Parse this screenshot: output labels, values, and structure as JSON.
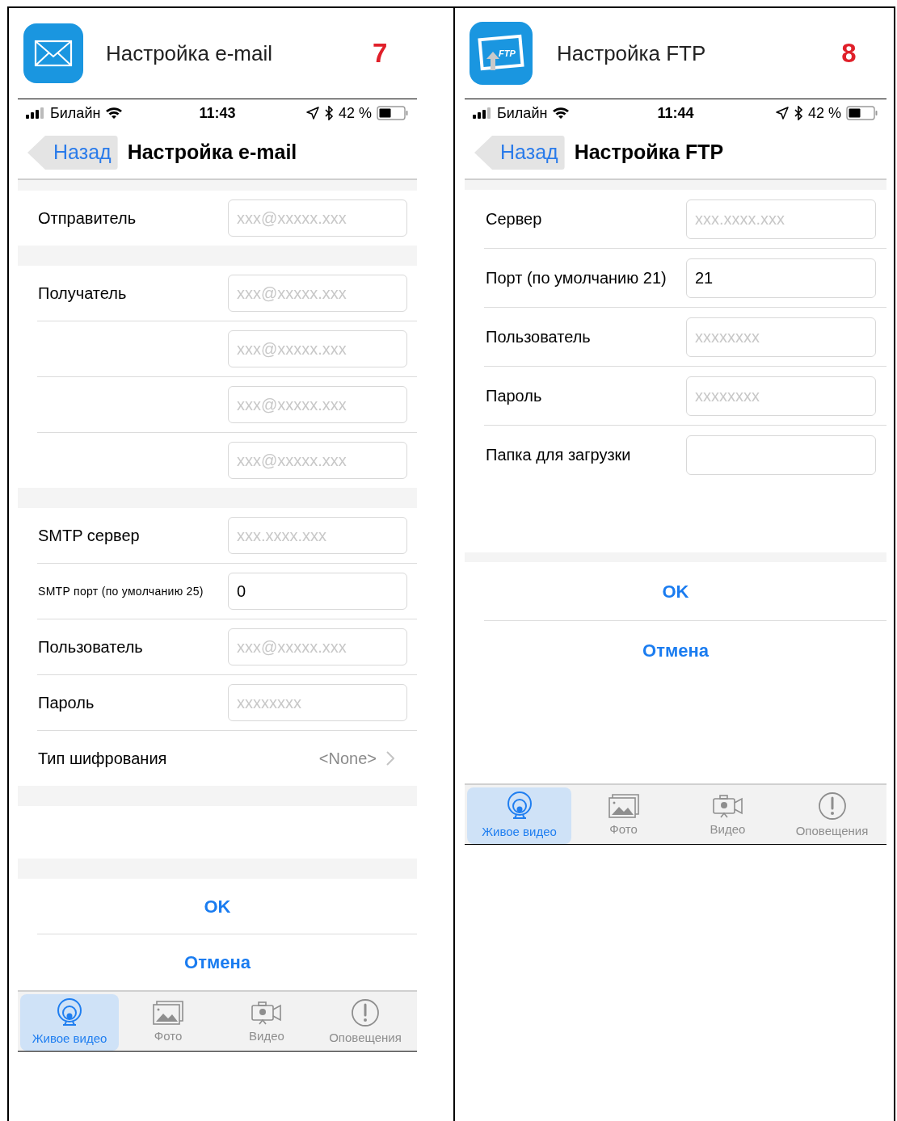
{
  "panels": [
    {
      "kind": "email",
      "title": "Настройка e-mail",
      "number": "7",
      "status_bar": {
        "carrier": "Билайн",
        "time": "11:43",
        "battery": "42 %"
      },
      "nav": {
        "back": "Назад",
        "title": "Настройка e-mail"
      },
      "items": [
        {
          "kind": "thin_gap"
        },
        {
          "kind": "field",
          "label": "Отправитель",
          "placeholder": "xxx@xxxxx.xxx"
        },
        {
          "kind": "gap"
        },
        {
          "kind": "field",
          "label": "Получатель",
          "placeholder": "xxx@xxxxx.xxx"
        },
        {
          "kind": "field",
          "placeholder": "xxx@xxxxx.xxx"
        },
        {
          "kind": "field",
          "placeholder": "xxx@xxxxx.xxx"
        },
        {
          "kind": "field",
          "placeholder": "xxx@xxxxx.xxx"
        },
        {
          "kind": "gap"
        },
        {
          "kind": "field",
          "label": "SMTP сервер",
          "placeholder": "xxx.xxxx.xxx"
        },
        {
          "kind": "field_compact",
          "label": "SMTP порт (по умолчанию 25)",
          "value": "0"
        },
        {
          "kind": "field",
          "label": "Пользователь",
          "placeholder": "xxx@xxxxx.xxx"
        },
        {
          "kind": "field",
          "label": "Пароль",
          "placeholder": "xxxxxxxx"
        },
        {
          "kind": "select",
          "label": "Тип шифрования",
          "value": "<None>"
        },
        {
          "kind": "gap"
        },
        {
          "kind": "blank"
        },
        {
          "kind": "gap"
        },
        {
          "kind": "action",
          "label": "OK"
        },
        {
          "kind": "action",
          "label": "Отмена"
        }
      ],
      "tabs": [
        {
          "label": "Живое видео",
          "selected": true
        },
        {
          "label": "Фото",
          "selected": false
        },
        {
          "label": "Видео",
          "selected": false
        },
        {
          "label": "Оповещения",
          "selected": false
        }
      ]
    },
    {
      "kind": "ftp",
      "icon_text": "FTP",
      "title": "Настройка FTP",
      "number": "8",
      "status_bar": {
        "carrier": "Билайн",
        "time": "11:44",
        "battery": "42 %"
      },
      "nav": {
        "back": "Назад",
        "title": "Настройка FTP"
      },
      "items": [
        {
          "kind": "thin_gap"
        },
        {
          "kind": "field",
          "label": "Сервер",
          "placeholder": "xxx.xxxx.xxx"
        },
        {
          "kind": "field",
          "label": "Порт (по умолчанию 21)",
          "value": "21"
        },
        {
          "kind": "field",
          "label": "Пользователь",
          "placeholder": "xxxxxxxx"
        },
        {
          "kind": "field",
          "label": "Пароль",
          "placeholder": "xxxxxxxx"
        },
        {
          "kind": "field",
          "label": "Папка для загрузки"
        },
        {
          "kind": "blank"
        },
        {
          "kind": "thin_gap"
        },
        {
          "kind": "action",
          "label": "OK"
        },
        {
          "kind": "action",
          "label": "Отмена"
        }
      ],
      "tabs": [
        {
          "label": "Живое видео",
          "selected": true
        },
        {
          "label": "Фото",
          "selected": false
        },
        {
          "label": "Видео",
          "selected": false
        },
        {
          "label": "Оповещения",
          "selected": false
        }
      ]
    }
  ]
}
